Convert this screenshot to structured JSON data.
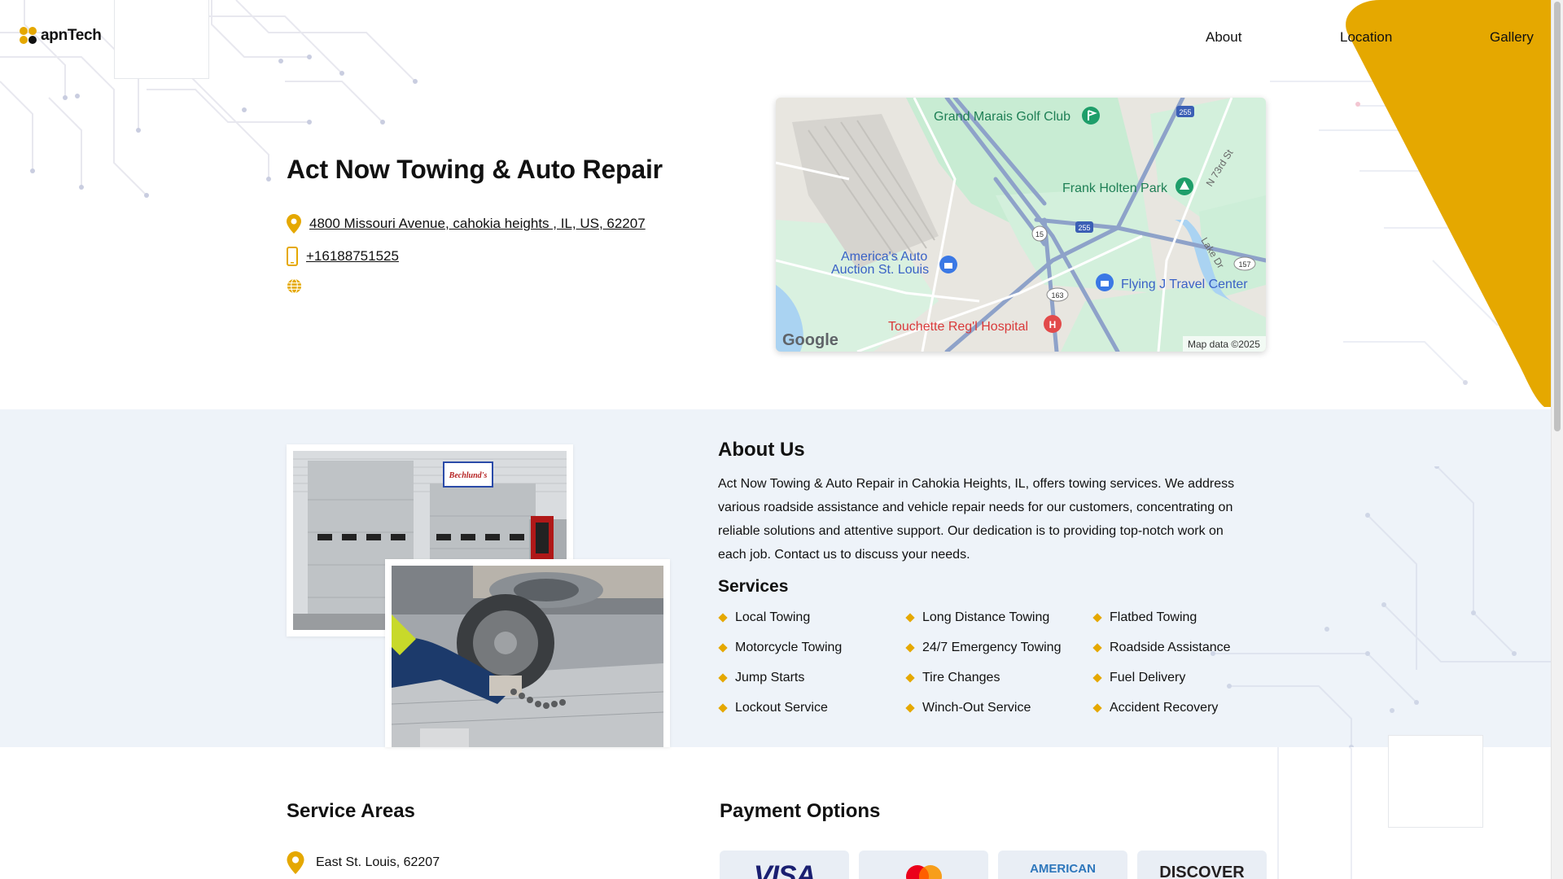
{
  "header": {
    "logo_text": "apnTech",
    "nav": [
      {
        "label": "About"
      },
      {
        "label": "Location"
      },
      {
        "label": "Gallery"
      }
    ]
  },
  "hero": {
    "title": "Act Now Towing & Auto Repair",
    "address": "4800 Missouri Avenue, cahokia heights , IL, US, 62207",
    "phone": "+16188751525"
  },
  "map": {
    "labels": {
      "golf": "Grand Marais Golf Club",
      "park": "Frank Holten Park",
      "auction_line1": "America's Auto",
      "auction_line2": "Auction St. Louis",
      "travel": "Flying J Travel Center",
      "hospital": "Touchette Reg'l Hospital",
      "street1": "N 73rd St",
      "street2": "Lake Dr",
      "route_15": "15",
      "route_163": "163",
      "route_157": "157",
      "route_255a": "255",
      "route_255b": "255"
    },
    "brand": "Google",
    "attribution": "Map data ©2025"
  },
  "about": {
    "title": "About Us",
    "text": "Act Now Towing & Auto Repair in Cahokia Heights, IL, offers towing services. We address various roadside assistance and vehicle repair needs for our customers, concentrating on reliable solutions and attentive support. Our dedication is to providing top-notch work on each job. Contact us to discuss your needs.",
    "photo_sign": "Bechlund's",
    "services_title": "Services",
    "services": [
      "Local Towing",
      "Long Distance Towing",
      "Flatbed Towing",
      "Motorcycle Towing",
      "24/7 Emergency Towing",
      "Roadside Assistance",
      "Jump Starts",
      "Tire Changes",
      "Fuel Delivery",
      "Lockout Service",
      "Winch-Out Service",
      "Accident Recovery"
    ]
  },
  "service_areas": {
    "title": "Service Areas",
    "items": [
      "East St. Louis, 62207"
    ]
  },
  "payment": {
    "title": "Payment Options",
    "cards": [
      "VISA",
      "mastercard",
      "AMERICAN",
      "DISCOVER"
    ]
  },
  "colors": {
    "accent": "#e5a800",
    "about_bg": "#eef3f9"
  }
}
